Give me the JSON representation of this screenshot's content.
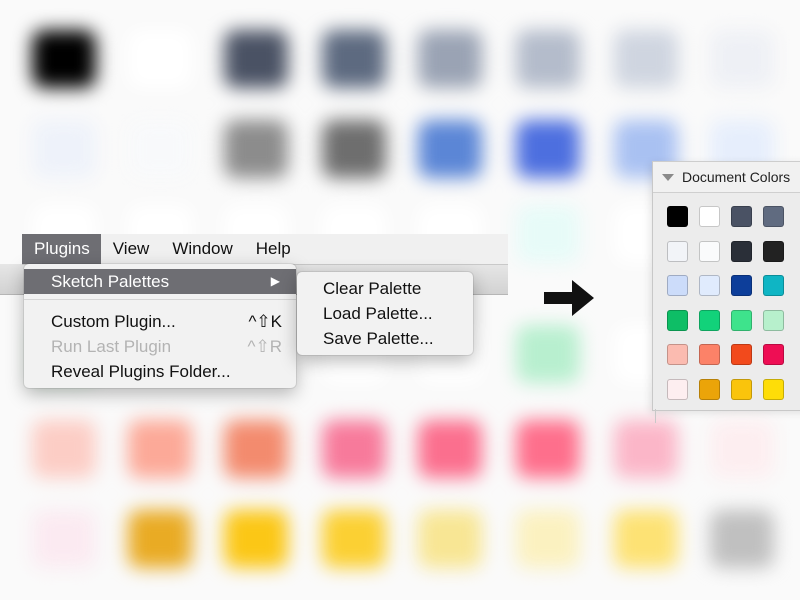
{
  "menubar": {
    "items": [
      "Plugins",
      "View",
      "Window",
      "Help"
    ],
    "active_index": 0
  },
  "plugins_menu": {
    "items": [
      {
        "label": "Sketch Palettes",
        "shortcut": "",
        "submenu_arrow": "▶",
        "state": "highlighted"
      },
      {
        "label": "Custom Plugin...",
        "shortcut": "^⇧K",
        "submenu_arrow": "",
        "state": "enabled"
      },
      {
        "label": "Run Last Plugin",
        "shortcut": "^⇧R",
        "submenu_arrow": "",
        "state": "disabled"
      },
      {
        "label": "Reveal Plugins Folder...",
        "shortcut": "",
        "submenu_arrow": "",
        "state": "enabled"
      }
    ]
  },
  "palettes_submenu": {
    "items": [
      "Clear Palette",
      "Load Palette...",
      "Save Palette..."
    ]
  },
  "arrow_icon": "right-arrow-icon",
  "doc_panel": {
    "title": "Document Colors",
    "disclosure_icon": "disclosure-triangle-icon",
    "colors": [
      [
        "#000000",
        "#ffffff",
        "#4a5264",
        "#606b80"
      ],
      [
        "#f2f4f8",
        "#fafbfc",
        "#2a2f38",
        "#222222"
      ],
      [
        "#ccdcfa",
        "#e0ebfd",
        "#0d3e9a",
        "#0fb5c4"
      ],
      [
        "#0ebe66",
        "#12d27a",
        "#3ee38c",
        "#b7f0cc"
      ],
      [
        "#fbbbb0",
        "#fc8268",
        "#f24a1c",
        "#ee0e54"
      ],
      [
        "#fdeef0",
        "#eba409",
        "#fac40c",
        "#fedd08"
      ]
    ]
  },
  "background_swatches": [
    [
      "#000000",
      "#ffffff",
      "#4a5264",
      "#5d6a80",
      "#9aa3b4",
      "#b4bccb",
      "#cfd5e0",
      "#eef0f5"
    ],
    [
      "#eef2fa",
      "#f8f9fb",
      "#8c8c8c",
      "#6e6e6e",
      "#5b86d6",
      "#4d6fdf",
      "#a9c1f2",
      "#e6eefc"
    ],
    [
      "#ffffff",
      "#ffffff",
      "#ffffff",
      "#ffffff",
      "#ffffff",
      "#e7fbf8",
      "#ffffff",
      "#ffffff"
    ],
    [
      "#d8f3df",
      "#ffffff",
      "#ffffff",
      "#ffffff",
      "#ffffff",
      "#b8efcf",
      "#ffffff",
      "#ffffff"
    ],
    [
      "#fccdc5",
      "#fca998",
      "#f38b6e",
      "#f77a9b",
      "#fb6f8e",
      "#fe6f8c",
      "#fbb6c8",
      "#fdeef0"
    ],
    [
      "#fbeaf1",
      "#e9ab24",
      "#fbc716",
      "#fbd033",
      "#f8e694",
      "#fbf1c0",
      "#fde274",
      "#c0c0c0"
    ]
  ]
}
